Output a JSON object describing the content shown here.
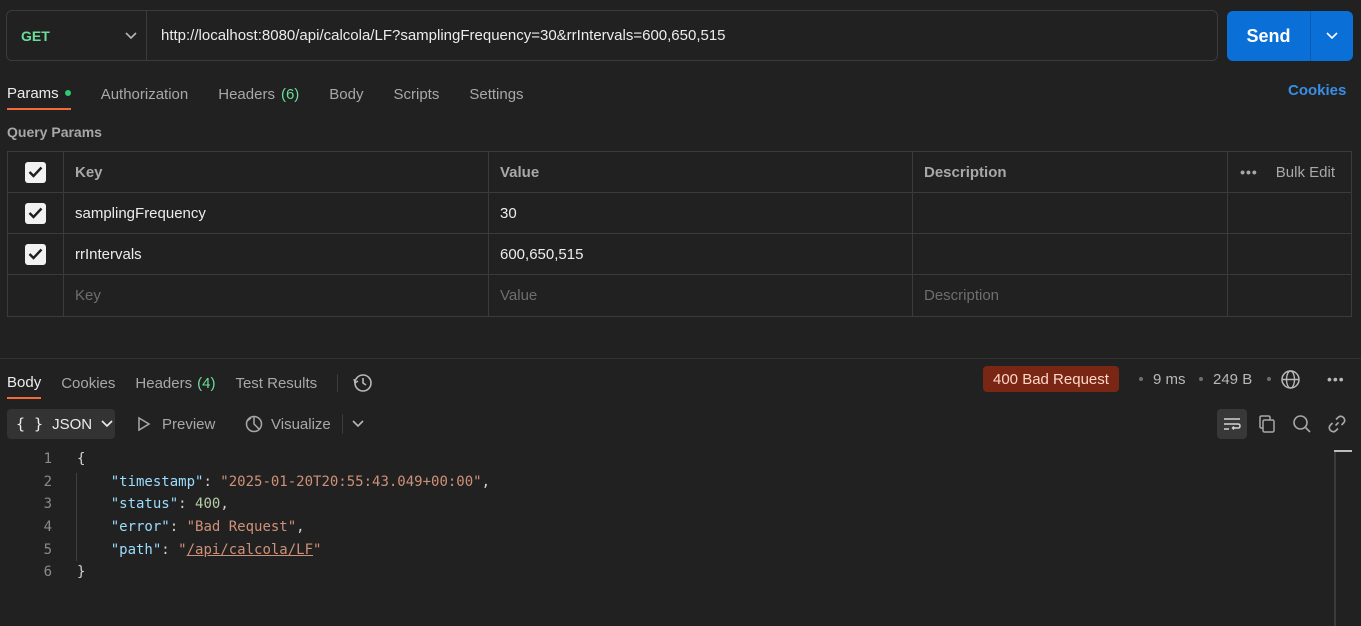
{
  "request": {
    "method": "GET",
    "url": "http://localhost:8080/api/calcola/LF?samplingFrequency=30&rrIntervals=600,650,515",
    "send_label": "Send"
  },
  "request_tabs": [
    {
      "label": "Params",
      "active": true
    },
    {
      "label": "Authorization"
    },
    {
      "label": "Headers",
      "count": "(6)"
    },
    {
      "label": "Body"
    },
    {
      "label": "Scripts"
    },
    {
      "label": "Settings"
    }
  ],
  "cookies_link": "Cookies",
  "query_params": {
    "title": "Query Params",
    "headers": {
      "key": "Key",
      "value": "Value",
      "description": "Description",
      "bulk_edit": "Bulk Edit"
    },
    "rows": [
      {
        "key": "samplingFrequency",
        "value": "30",
        "description": "",
        "checked": true
      },
      {
        "key": "rrIntervals",
        "value": "600,650,515",
        "description": "",
        "checked": true
      }
    ],
    "placeholders": {
      "key": "Key",
      "value": "Value",
      "description": "Description"
    }
  },
  "response_tabs": [
    {
      "label": "Body",
      "active": true
    },
    {
      "label": "Cookies"
    },
    {
      "label": "Headers",
      "count": "(4)"
    },
    {
      "label": "Test Results"
    }
  ],
  "response_meta": {
    "status": "400 Bad Request",
    "time": "9 ms",
    "size": "249 B"
  },
  "viewer": {
    "format": "JSON",
    "braces": "{ }",
    "preview": "Preview",
    "visualize": "Visualize"
  },
  "code_lines": [
    {
      "n": "1",
      "parts": [
        {
          "t": "{",
          "c": "p"
        }
      ]
    },
    {
      "n": "2",
      "parts": [
        {
          "t": "    ",
          "c": "p"
        },
        {
          "t": "\"timestamp\"",
          "c": "key"
        },
        {
          "t": ": ",
          "c": "p"
        },
        {
          "t": "\"2025-01-20T20:55:43.049+00:00\"",
          "c": "str"
        },
        {
          "t": ",",
          "c": "p"
        }
      ]
    },
    {
      "n": "3",
      "parts": [
        {
          "t": "    ",
          "c": "p"
        },
        {
          "t": "\"status\"",
          "c": "key"
        },
        {
          "t": ": ",
          "c": "p"
        },
        {
          "t": "400",
          "c": "num"
        },
        {
          "t": ",",
          "c": "p"
        }
      ]
    },
    {
      "n": "4",
      "parts": [
        {
          "t": "    ",
          "c": "p"
        },
        {
          "t": "\"error\"",
          "c": "key"
        },
        {
          "t": ": ",
          "c": "p"
        },
        {
          "t": "\"Bad Request\"",
          "c": "str"
        },
        {
          "t": ",",
          "c": "p"
        }
      ]
    },
    {
      "n": "5",
      "parts": [
        {
          "t": "    ",
          "c": "p"
        },
        {
          "t": "\"path\"",
          "c": "key"
        },
        {
          "t": ": ",
          "c": "p"
        },
        {
          "t": "\"",
          "c": "str"
        },
        {
          "t": "/api/calcola/LF",
          "c": "str link"
        },
        {
          "t": "\"",
          "c": "str"
        }
      ]
    },
    {
      "n": "6",
      "parts": [
        {
          "t": "}",
          "c": "p"
        }
      ]
    }
  ],
  "colors": {
    "accent_send": "#0a6fd6",
    "method_get": "#6bdd9a",
    "active_tab_underline": "#f26b3a",
    "status_error_bg": "#7a2615",
    "link": "#3a8ee6"
  },
  "icons": [
    "chevron-down-icon",
    "check-icon",
    "ellipsis-icon",
    "history-icon",
    "globe-icon",
    "more-icon",
    "play-icon",
    "visualize-icon",
    "wrap-icon",
    "copy-icon",
    "search-icon",
    "link-icon"
  ]
}
